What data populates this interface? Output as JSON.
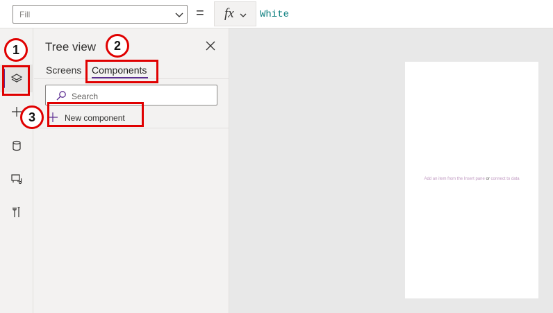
{
  "formula_bar": {
    "property": "Fill",
    "equals": "=",
    "fx_label": "fx",
    "formula": "White"
  },
  "rail": {
    "items": [
      "menu-icon",
      "layers-icon",
      "add-icon",
      "data-icon",
      "media-icon",
      "tools-icon"
    ],
    "active_index": 1
  },
  "tree_view": {
    "title": "Tree view",
    "tabs": [
      "Screens",
      "Components"
    ],
    "active_tab": "Components",
    "search_placeholder": "Search",
    "new_component_label": "New component"
  },
  "canvas": {
    "hint_prefix": "Add an item from the Insert pane",
    "hint_or": "or",
    "hint_suffix": "connect to data"
  },
  "annotations": {
    "steps": [
      "1",
      "2",
      "3"
    ],
    "color": "#e00000"
  },
  "theme": {
    "accent": "#5c2d91",
    "formula_color": "#0e8080"
  }
}
